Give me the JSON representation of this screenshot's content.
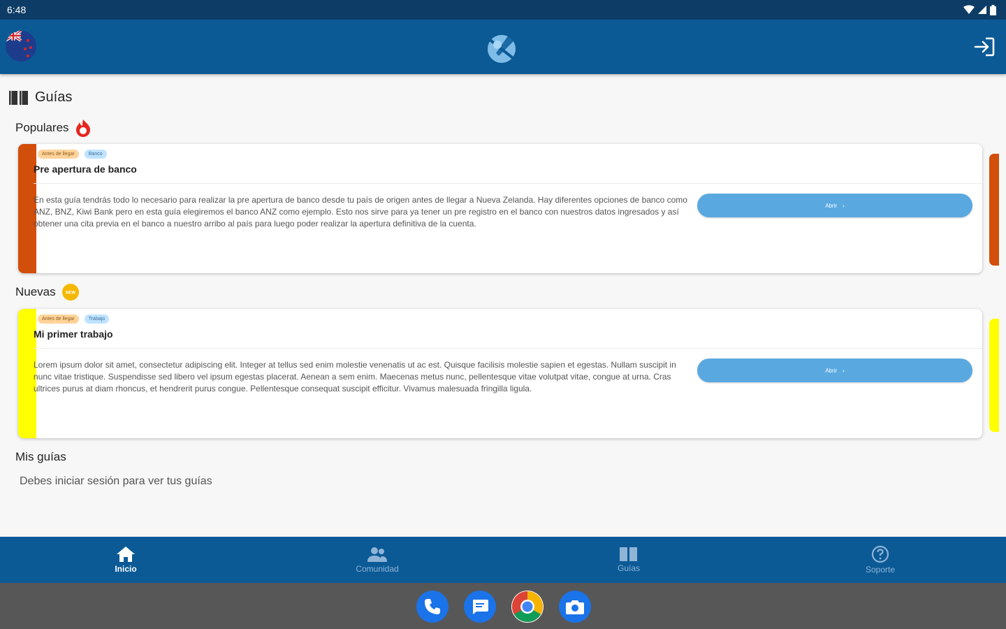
{
  "status_bar": {
    "time": "6:48"
  },
  "colors": {
    "app_bar": "#0b5a96",
    "accent": "#59a9e0",
    "stripe_popular": "#d24e0b",
    "stripe_new": "#ffff00"
  },
  "header": {
    "logo_icon": "globe-plane-icon",
    "login_icon": "login-icon"
  },
  "guides_title": "Guías",
  "sections": {
    "popular": {
      "title": "Populares",
      "icon": "fire-icon"
    },
    "new": {
      "title": "Nuevas",
      "icon": "new-badge-icon",
      "badge_text": "NEW"
    },
    "mine": {
      "title": "Mis guías",
      "message": "Debes iniciar sesión para ver tus guías"
    }
  },
  "cards": [
    {
      "tags": [
        "Antes de llegar",
        "Banco"
      ],
      "title": "Pre apertura de banco",
      "text": "En esta guía tendrás todo lo necesario para realizar la pre apertura de banco desde tu país de origen antes de llegar a Nueva Zelanda. Hay diferentes opciones de banco como ANZ, BNZ, Kiwi Bank pero en esta guía elegiremos el banco ANZ como ejemplo. Esto nos sirve para ya tener un pre registro en el banco con nuestros datos ingresados y así obtener una cita previa en el banco a nuestro arribo al país para luego poder realizar la apertura definitiva de la cuenta.",
      "button": "Abrir"
    },
    {
      "tags": [
        "Antes de llegar",
        "Trabajo"
      ],
      "title": "Mi primer trabajo",
      "text": "Lorem ipsum dolor sit amet, consectetur adipiscing elit. Integer at tellus sed enim molestie venenatis ut ac est. Quisque facilisis molestie sapien et egestas. Nullam suscipit in nunc vitae tristique. Suspendisse sed libero vel ipsum egestas placerat. Aenean a sem enim. Maecenas metus nunc, pellentesque vitae volutpat vitae, congue at urna. Cras ultrices purus at diam rhoncus, et hendrerit purus congue. Pellentesque consequat suscipit efficitur. Vivamus malesuada fringilla ligula.",
      "button": "Abrir"
    }
  ],
  "bottom_nav": [
    {
      "label": "Inicio",
      "icon": "home-icon",
      "active": true
    },
    {
      "label": "Comunidad",
      "icon": "community-icon",
      "active": false
    },
    {
      "label": "Guías",
      "icon": "book-icon",
      "active": false
    },
    {
      "label": "Soporte",
      "icon": "help-icon",
      "active": false
    }
  ],
  "dock": [
    "phone-icon",
    "messages-icon",
    "chrome-icon",
    "camera-icon"
  ]
}
